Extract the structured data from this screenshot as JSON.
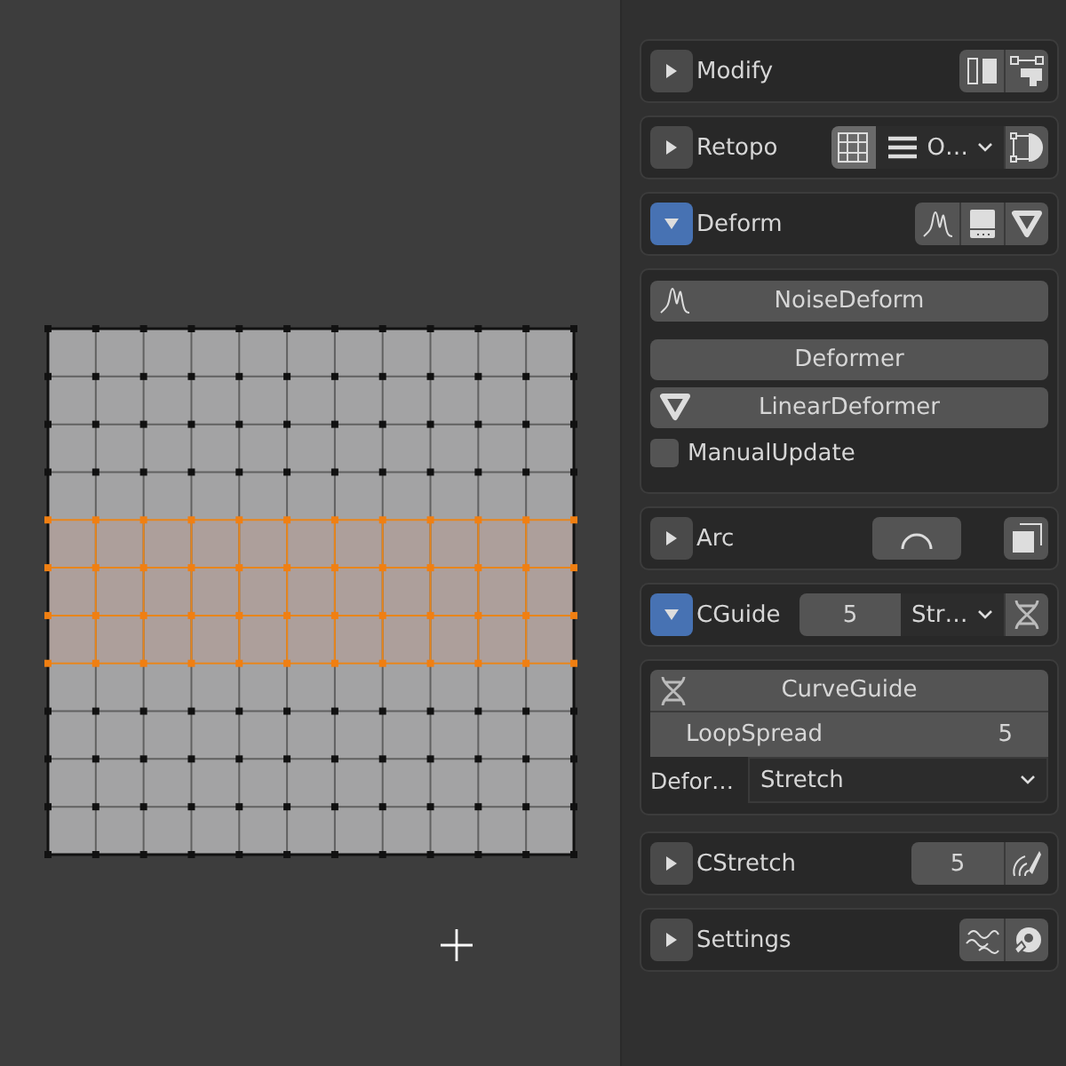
{
  "modify": {
    "label": "Modify",
    "expanded": false
  },
  "retopo": {
    "label": "Retopo",
    "expanded": false,
    "grid_on": true,
    "dropdown": "O…"
  },
  "deform": {
    "label": "Deform",
    "expanded": true,
    "buttons": [
      {
        "label": "NoiseDeform"
      },
      {
        "label": "Deformer"
      },
      {
        "label": "LinearDeformer"
      }
    ],
    "manual_update": {
      "label": "ManualUpdate",
      "checked": false
    }
  },
  "arc": {
    "label": "Arc",
    "expanded": false
  },
  "cguide": {
    "label": "CGuide",
    "expanded": true,
    "count": "5",
    "mode": "Str…",
    "curve_guide": {
      "title": "CurveGuide",
      "loop_spread_label": "LoopSpread",
      "loop_spread": "5",
      "deformer_label": "Defor…",
      "deformer": "Stretch"
    }
  },
  "cstretch": {
    "label": "CStretch",
    "expanded": false,
    "count": "5"
  },
  "settings": {
    "label": "Settings",
    "expanded": false
  }
}
